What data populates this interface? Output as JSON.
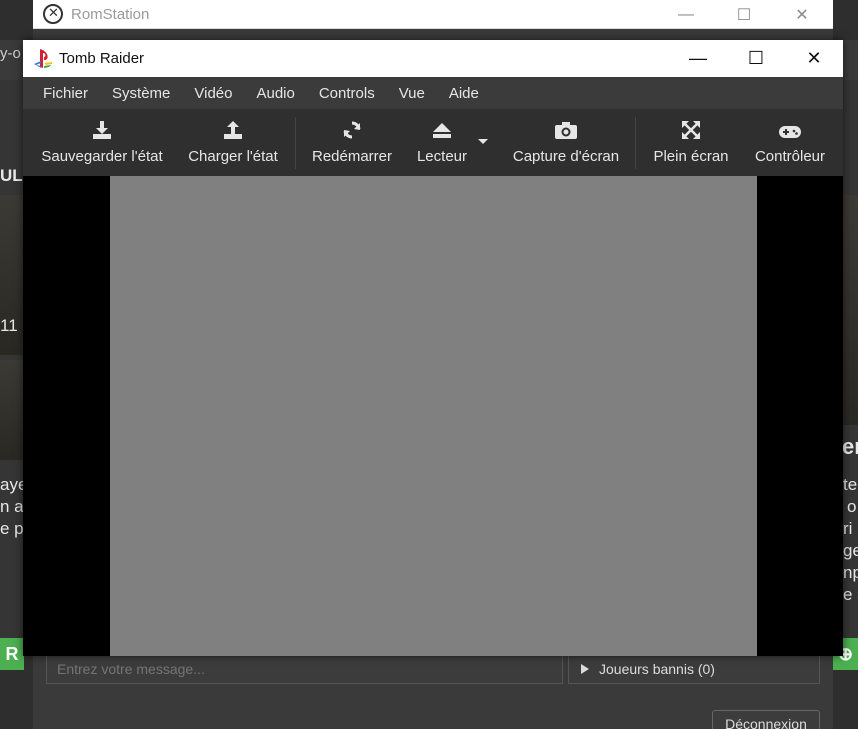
{
  "background": {
    "url_fragment": "y-o",
    "left_texts": [
      "ULA",
      "11",
      "aye",
      "n a",
      "e p"
    ],
    "right_texts": [
      "er",
      "te",
      "o",
      "ri",
      "ge",
      "np",
      "e a"
    ],
    "left_button": "R",
    "right_button_symbol": "⊕"
  },
  "romstation": {
    "title": "RomStation",
    "controls": {
      "minimize": "—",
      "maximize": "☐",
      "close": "✕"
    },
    "chat_placeholder": "Entrez votre message...",
    "banned_players": "Joueurs bannis (0)",
    "disconnect": "Déconnexion"
  },
  "emulator": {
    "title": "Tomb Raider",
    "controls": {
      "minimize": "—",
      "maximize": "☐",
      "close": "✕"
    },
    "menu": [
      "Fichier",
      "Système",
      "Vidéo",
      "Audio",
      "Controls",
      "Vue",
      "Aide"
    ],
    "toolbar": {
      "save_state": "Sauvegarder l'état",
      "load_state": "Charger l'état",
      "restart": "Redémarrer",
      "player": "Lecteur",
      "screenshot": "Capture d'écran",
      "fullscreen": "Plein écran",
      "controller": "Contrôleur"
    }
  },
  "colors": {
    "game_screen": "#808080",
    "accent_green": "#4caf50"
  }
}
